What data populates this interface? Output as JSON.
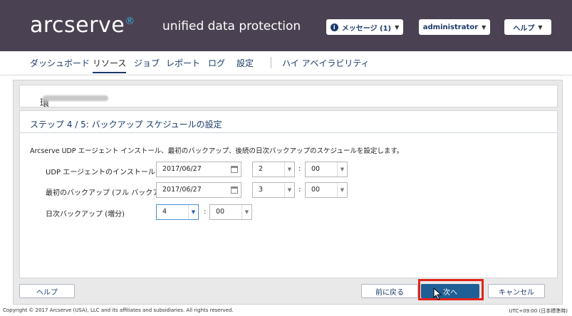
{
  "header": {
    "logo": "arcserve",
    "product": "unified data protection",
    "messages_label": "メッセージ (1)",
    "user_label": "administrator",
    "help_label": "ヘルプ"
  },
  "nav": {
    "items": [
      "ダッシュボード",
      "リソース",
      "ジョブ",
      "レポート",
      "ログ",
      "設定",
      "ハイ アベイラビリティ"
    ],
    "active": "リソース"
  },
  "wizard": {
    "title_prefix": "環境設定ウィザード > プラン :"
  },
  "step": {
    "title": "ステップ 4 / 5: バックアップ スケジュールの設定",
    "description": "Arcserve UDP エージェント インストール、最初のバックアップ、後続の日次バックアップのスケジュールを設定します。",
    "rows": [
      {
        "label": "UDP エージェントのインストール",
        "date": "2017/06/27",
        "hour": "2",
        "minute": "00"
      },
      {
        "label": "最初のバックアップ (フル バックアップ)",
        "date": "2017/06/27",
        "hour": "3",
        "minute": "00"
      },
      {
        "label": "日次バックアップ (増分)",
        "hour": "4",
        "minute": "00"
      }
    ],
    "colon": ":"
  },
  "buttons": {
    "help": "ヘルプ",
    "back": "前に戻る",
    "next": "次へ",
    "cancel": "キャンセル"
  },
  "footer": {
    "copyright": "Copyright © 2017 Arcserve (USA), LLC and its affiliates and subsidiaries. All rights reserved.",
    "timezone": "UTC+09:00 (日本標準時)"
  },
  "colors": {
    "header_bg": "#4a4152",
    "accent": "#1f5f96",
    "highlight": "#e2231a"
  }
}
